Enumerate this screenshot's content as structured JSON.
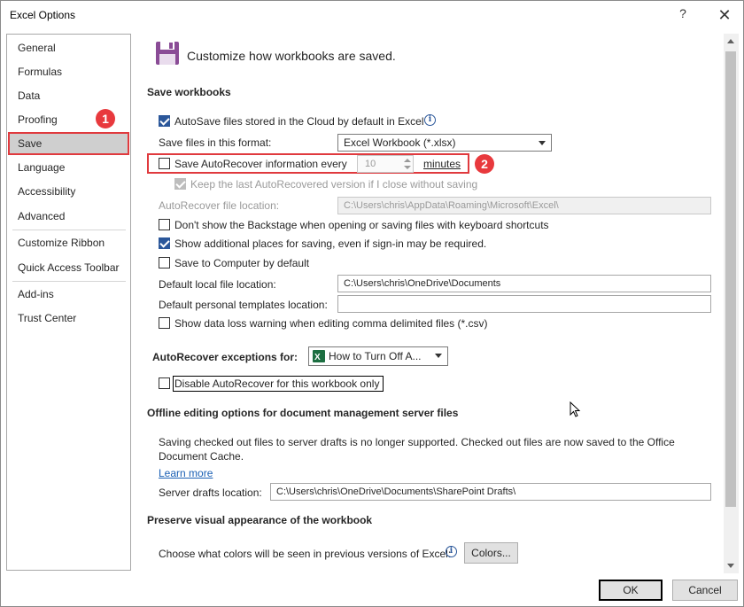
{
  "window": {
    "title": "Excel Options",
    "help_glyph": "?",
    "close_glyph": "✕"
  },
  "sidebar": {
    "items": [
      {
        "label": "General"
      },
      {
        "label": "Formulas"
      },
      {
        "label": "Data"
      },
      {
        "label": "Proofing"
      },
      {
        "label": "Save",
        "selected": true
      },
      {
        "label": "Language"
      },
      {
        "label": "Accessibility"
      },
      {
        "label": "Advanced"
      },
      {
        "label": "Customize Ribbon"
      },
      {
        "label": "Quick Access Toolbar"
      },
      {
        "label": "Add-ins"
      },
      {
        "label": "Trust Center"
      }
    ]
  },
  "annotations": {
    "badge1": "1",
    "badge2": "2"
  },
  "content": {
    "header": "Customize how workbooks are saved.",
    "header_icon": "floppy-disk-icon",
    "save_workbooks": {
      "title": "Save workbooks",
      "autosave_label": "AutoSave files stored in the Cloud by default in Excel",
      "autosave_checked": true,
      "format_label": "Save files in this format:",
      "format_value": "Excel Workbook (*.xlsx)",
      "autorecover_label": "Save AutoRecover information every",
      "autorecover_checked": false,
      "autorecover_minutes": "10",
      "minutes_label": "minutes",
      "keep_last_label": "Keep the last AutoRecovered version if I close without saving",
      "keep_last_checked": true,
      "autorecover_location_label": "AutoRecover file location:",
      "autorecover_location_value": "C:\\Users\\chris\\AppData\\Roaming\\Microsoft\\Excel\\",
      "backstage_label": "Don't show the Backstage when opening or saving files with keyboard shortcuts",
      "backstage_checked": false,
      "additional_places_label": "Show additional places for saving, even if sign-in may be required.",
      "additional_places_checked": true,
      "save_to_computer_label": "Save to Computer by default",
      "save_to_computer_checked": false,
      "default_local_label": "Default local file location:",
      "default_local_value": "C:\\Users\\chris\\OneDrive\\Documents",
      "default_templates_label": "Default personal templates location:",
      "default_templates_value": "",
      "data_loss_label": "Show data loss warning when editing comma delimited files (*.csv)",
      "data_loss_checked": false
    },
    "exceptions": {
      "title": "AutoRecover exceptions for:",
      "workbook_value": "How to Turn Off A...",
      "disable_label": "Disable AutoRecover for this workbook only",
      "disable_checked": false
    },
    "offline": {
      "title": "Offline editing options for document management server files",
      "description_line1": "Saving checked out files to server drafts is no longer supported. Checked out files are now saved to the Office",
      "description_line2": "Document Cache.",
      "learn_more": "Learn more",
      "server_drafts_label": "Server drafts location:",
      "server_drafts_value": "C:\\Users\\chris\\OneDrive\\Documents\\SharePoint Drafts\\"
    },
    "preserve": {
      "title": "Preserve visual appearance of the workbook",
      "colors_label": "Choose what colors will be seen in previous versions of Excel:",
      "colors_button": "Colors..."
    }
  },
  "footer": {
    "ok": "OK",
    "cancel": "Cancel"
  },
  "colors": {
    "accent": "#2b579a",
    "highlight": "#e03a3e",
    "excel_green": "#1d6f42"
  }
}
